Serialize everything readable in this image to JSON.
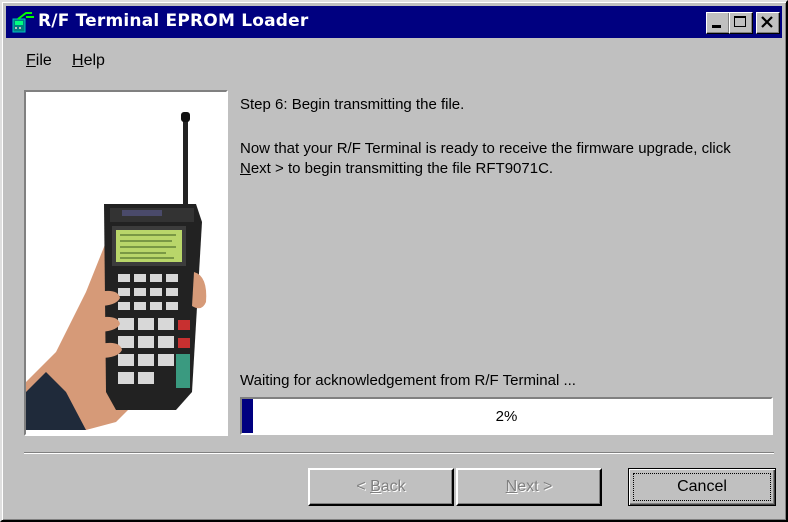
{
  "window": {
    "title": "R/F Terminal EPROM Loader"
  },
  "menu": {
    "file": {
      "mnemonic": "F",
      "rest": "ile"
    },
    "help": {
      "mnemonic": "H",
      "rest": "elp"
    }
  },
  "wizard": {
    "step_title": "Step 6: Begin transmitting the file.",
    "body_part1": "Now that your R/F Terminal is ready to receive the firmware upgrade, click ",
    "body_mnemonic": "N",
    "body_part2": "ext > to begin transmitting the file RFT9071C.",
    "status": "Waiting for acknowledgement from R/F Terminal ...",
    "progress_value": 2,
    "progress_label": "2%"
  },
  "buttons": {
    "back": {
      "prefix": "< ",
      "mnemonic": "B",
      "rest": "ack"
    },
    "next": {
      "mnemonic": "N",
      "rest": "ext >"
    },
    "cancel": "Cancel"
  },
  "colors": {
    "titlebar": "#000080",
    "face": "#c0c0c0",
    "progress_fill": "#000080"
  },
  "icons": {
    "app": "rf-terminal-app-icon",
    "minimize": "minimize-icon",
    "maximize": "maximize-icon",
    "close": "close-icon",
    "illustration": "handheld-terminal-illustration"
  }
}
